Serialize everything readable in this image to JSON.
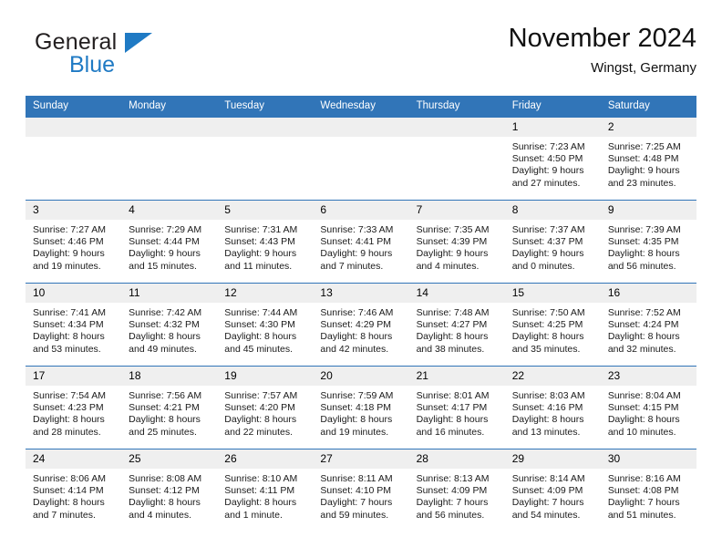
{
  "brand": {
    "name_top": "General",
    "name_bottom": "Blue",
    "accent_color": "#1f7ac4"
  },
  "header": {
    "title": "November 2024",
    "subtitle": "Wingst, Germany"
  },
  "theme": {
    "header_blue": "#3175b8",
    "daynum_gray": "#efefef"
  },
  "weekday_headers": [
    "Sunday",
    "Monday",
    "Tuesday",
    "Wednesday",
    "Thursday",
    "Friday",
    "Saturday"
  ],
  "weeks": [
    [
      {
        "day": "",
        "sunrise": "",
        "sunset": "",
        "daylight1": "",
        "daylight2": ""
      },
      {
        "day": "",
        "sunrise": "",
        "sunset": "",
        "daylight1": "",
        "daylight2": ""
      },
      {
        "day": "",
        "sunrise": "",
        "sunset": "",
        "daylight1": "",
        "daylight2": ""
      },
      {
        "day": "",
        "sunrise": "",
        "sunset": "",
        "daylight1": "",
        "daylight2": ""
      },
      {
        "day": "",
        "sunrise": "",
        "sunset": "",
        "daylight1": "",
        "daylight2": ""
      },
      {
        "day": "1",
        "sunrise": "Sunrise: 7:23 AM",
        "sunset": "Sunset: 4:50 PM",
        "daylight1": "Daylight: 9 hours",
        "daylight2": "and 27 minutes."
      },
      {
        "day": "2",
        "sunrise": "Sunrise: 7:25 AM",
        "sunset": "Sunset: 4:48 PM",
        "daylight1": "Daylight: 9 hours",
        "daylight2": "and 23 minutes."
      }
    ],
    [
      {
        "day": "3",
        "sunrise": "Sunrise: 7:27 AM",
        "sunset": "Sunset: 4:46 PM",
        "daylight1": "Daylight: 9 hours",
        "daylight2": "and 19 minutes."
      },
      {
        "day": "4",
        "sunrise": "Sunrise: 7:29 AM",
        "sunset": "Sunset: 4:44 PM",
        "daylight1": "Daylight: 9 hours",
        "daylight2": "and 15 minutes."
      },
      {
        "day": "5",
        "sunrise": "Sunrise: 7:31 AM",
        "sunset": "Sunset: 4:43 PM",
        "daylight1": "Daylight: 9 hours",
        "daylight2": "and 11 minutes."
      },
      {
        "day": "6",
        "sunrise": "Sunrise: 7:33 AM",
        "sunset": "Sunset: 4:41 PM",
        "daylight1": "Daylight: 9 hours",
        "daylight2": "and 7 minutes."
      },
      {
        "day": "7",
        "sunrise": "Sunrise: 7:35 AM",
        "sunset": "Sunset: 4:39 PM",
        "daylight1": "Daylight: 9 hours",
        "daylight2": "and 4 minutes."
      },
      {
        "day": "8",
        "sunrise": "Sunrise: 7:37 AM",
        "sunset": "Sunset: 4:37 PM",
        "daylight1": "Daylight: 9 hours",
        "daylight2": "and 0 minutes."
      },
      {
        "day": "9",
        "sunrise": "Sunrise: 7:39 AM",
        "sunset": "Sunset: 4:35 PM",
        "daylight1": "Daylight: 8 hours",
        "daylight2": "and 56 minutes."
      }
    ],
    [
      {
        "day": "10",
        "sunrise": "Sunrise: 7:41 AM",
        "sunset": "Sunset: 4:34 PM",
        "daylight1": "Daylight: 8 hours",
        "daylight2": "and 53 minutes."
      },
      {
        "day": "11",
        "sunrise": "Sunrise: 7:42 AM",
        "sunset": "Sunset: 4:32 PM",
        "daylight1": "Daylight: 8 hours",
        "daylight2": "and 49 minutes."
      },
      {
        "day": "12",
        "sunrise": "Sunrise: 7:44 AM",
        "sunset": "Sunset: 4:30 PM",
        "daylight1": "Daylight: 8 hours",
        "daylight2": "and 45 minutes."
      },
      {
        "day": "13",
        "sunrise": "Sunrise: 7:46 AM",
        "sunset": "Sunset: 4:29 PM",
        "daylight1": "Daylight: 8 hours",
        "daylight2": "and 42 minutes."
      },
      {
        "day": "14",
        "sunrise": "Sunrise: 7:48 AM",
        "sunset": "Sunset: 4:27 PM",
        "daylight1": "Daylight: 8 hours",
        "daylight2": "and 38 minutes."
      },
      {
        "day": "15",
        "sunrise": "Sunrise: 7:50 AM",
        "sunset": "Sunset: 4:25 PM",
        "daylight1": "Daylight: 8 hours",
        "daylight2": "and 35 minutes."
      },
      {
        "day": "16",
        "sunrise": "Sunrise: 7:52 AM",
        "sunset": "Sunset: 4:24 PM",
        "daylight1": "Daylight: 8 hours",
        "daylight2": "and 32 minutes."
      }
    ],
    [
      {
        "day": "17",
        "sunrise": "Sunrise: 7:54 AM",
        "sunset": "Sunset: 4:23 PM",
        "daylight1": "Daylight: 8 hours",
        "daylight2": "and 28 minutes."
      },
      {
        "day": "18",
        "sunrise": "Sunrise: 7:56 AM",
        "sunset": "Sunset: 4:21 PM",
        "daylight1": "Daylight: 8 hours",
        "daylight2": "and 25 minutes."
      },
      {
        "day": "19",
        "sunrise": "Sunrise: 7:57 AM",
        "sunset": "Sunset: 4:20 PM",
        "daylight1": "Daylight: 8 hours",
        "daylight2": "and 22 minutes."
      },
      {
        "day": "20",
        "sunrise": "Sunrise: 7:59 AM",
        "sunset": "Sunset: 4:18 PM",
        "daylight1": "Daylight: 8 hours",
        "daylight2": "and 19 minutes."
      },
      {
        "day": "21",
        "sunrise": "Sunrise: 8:01 AM",
        "sunset": "Sunset: 4:17 PM",
        "daylight1": "Daylight: 8 hours",
        "daylight2": "and 16 minutes."
      },
      {
        "day": "22",
        "sunrise": "Sunrise: 8:03 AM",
        "sunset": "Sunset: 4:16 PM",
        "daylight1": "Daylight: 8 hours",
        "daylight2": "and 13 minutes."
      },
      {
        "day": "23",
        "sunrise": "Sunrise: 8:04 AM",
        "sunset": "Sunset: 4:15 PM",
        "daylight1": "Daylight: 8 hours",
        "daylight2": "and 10 minutes."
      }
    ],
    [
      {
        "day": "24",
        "sunrise": "Sunrise: 8:06 AM",
        "sunset": "Sunset: 4:14 PM",
        "daylight1": "Daylight: 8 hours",
        "daylight2": "and 7 minutes."
      },
      {
        "day": "25",
        "sunrise": "Sunrise: 8:08 AM",
        "sunset": "Sunset: 4:12 PM",
        "daylight1": "Daylight: 8 hours",
        "daylight2": "and 4 minutes."
      },
      {
        "day": "26",
        "sunrise": "Sunrise: 8:10 AM",
        "sunset": "Sunset: 4:11 PM",
        "daylight1": "Daylight: 8 hours",
        "daylight2": "and 1 minute."
      },
      {
        "day": "27",
        "sunrise": "Sunrise: 8:11 AM",
        "sunset": "Sunset: 4:10 PM",
        "daylight1": "Daylight: 7 hours",
        "daylight2": "and 59 minutes."
      },
      {
        "day": "28",
        "sunrise": "Sunrise: 8:13 AM",
        "sunset": "Sunset: 4:09 PM",
        "daylight1": "Daylight: 7 hours",
        "daylight2": "and 56 minutes."
      },
      {
        "day": "29",
        "sunrise": "Sunrise: 8:14 AM",
        "sunset": "Sunset: 4:09 PM",
        "daylight1": "Daylight: 7 hours",
        "daylight2": "and 54 minutes."
      },
      {
        "day": "30",
        "sunrise": "Sunrise: 8:16 AM",
        "sunset": "Sunset: 4:08 PM",
        "daylight1": "Daylight: 7 hours",
        "daylight2": "and 51 minutes."
      }
    ]
  ]
}
